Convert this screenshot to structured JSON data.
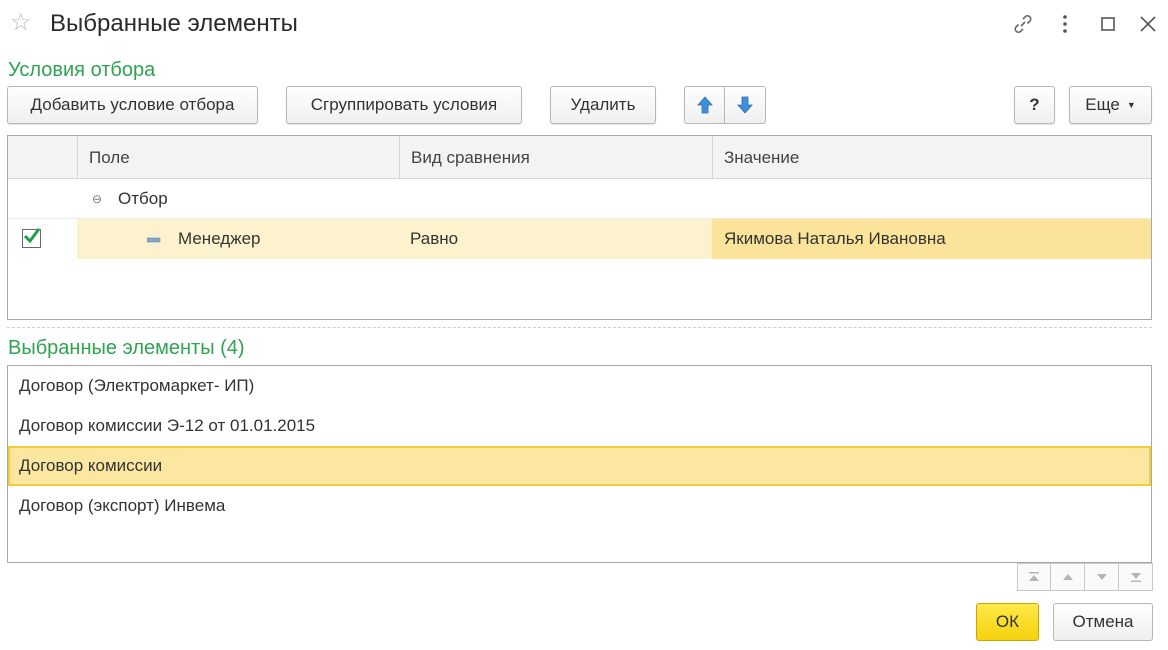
{
  "window": {
    "title": "Выбранные элементы",
    "icons": [
      "star-icon",
      "link-icon",
      "more-icon",
      "maximize-icon",
      "close-icon"
    ]
  },
  "filter_section": {
    "title": "Условия отбора",
    "toolbar": {
      "add_label": "Добавить условие отбора",
      "group_label": "Сгруппировать условия",
      "delete_label": "Удалить",
      "help_label": "?",
      "more_label": "Еще"
    },
    "columns": [
      "Поле",
      "Вид сравнения",
      "Значение"
    ],
    "group_row": {
      "label": "Отбор"
    },
    "rows": [
      {
        "checked": true,
        "field": "Менеджер",
        "comparison": "Равно",
        "value": "Якимова Наталья Ивановна"
      }
    ]
  },
  "selected_section": {
    "title": "Выбранные элементы (4)",
    "items": [
      "Договор (Электромаркет- ИП)",
      "Договор комиссии Э-12 от 01.01.2015",
      "Договор комиссии",
      "Договор (экспорт) Инвема"
    ],
    "selected_index": 2
  },
  "footer": {
    "ok_label": "ОК",
    "cancel_label": "Отмена"
  },
  "colors": {
    "accent_green": "#2ea44f",
    "selection": "#fce7a1",
    "ok_button": "#f5d20c",
    "arrow_blue": "#3f8fd8"
  }
}
